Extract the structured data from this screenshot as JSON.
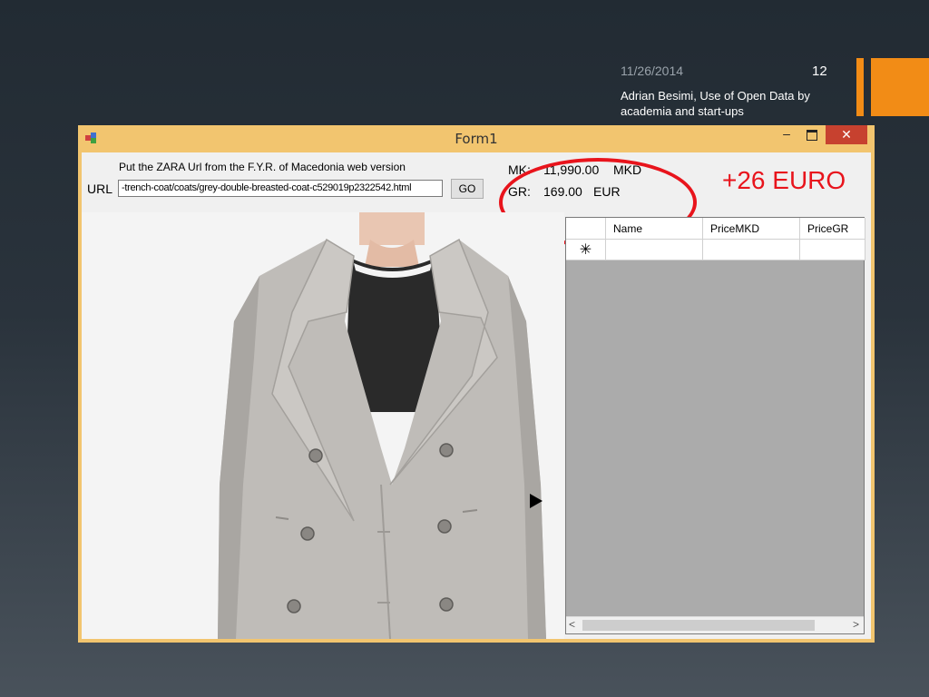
{
  "slide": {
    "date": "11/26/2014",
    "number": "12",
    "author": "Adrian Besimi, Use of Open Data by academia and start-ups",
    "accent_color": "#f28c16"
  },
  "window": {
    "title": "Form1",
    "minimize_label": "–",
    "close_label": "✕",
    "frame_color": "#f2c56f"
  },
  "form": {
    "instruction": "Put the ZARA Url from the F.Y.R. of Macedonia web version",
    "url_label": "URL",
    "url_value": "-trench-coat/coats/grey-double-breasted-coat-c529019p2322542.html",
    "go_label": "GO",
    "mk_label": "MK:",
    "mk_value": "11,990.00",
    "mk_currency": "MKD",
    "gr_label": "GR:",
    "gr_value": "169.00",
    "gr_currency": "EUR"
  },
  "annotation": {
    "text": "+26 EURO",
    "color": "#e8141c"
  },
  "grid": {
    "columns": [
      "Name",
      "PriceMKD",
      "PriceGR"
    ],
    "new_row_marker": "✳"
  },
  "image": {
    "subject": "grey-double-breasted-coat"
  }
}
